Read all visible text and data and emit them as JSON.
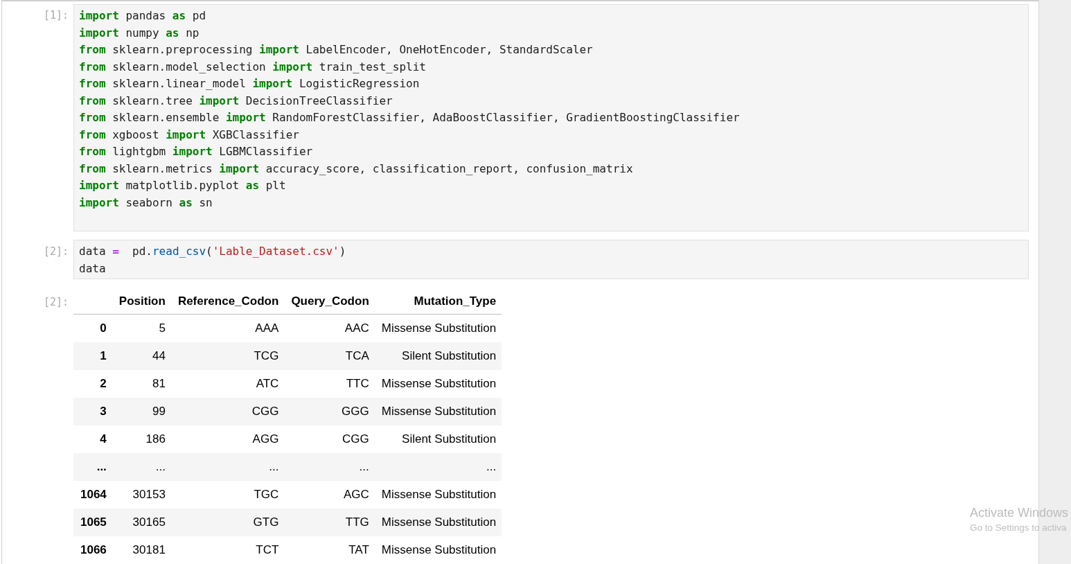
{
  "cells": [
    {
      "prompt": "[1]:",
      "lines": [
        [
          {
            "text": "import",
            "kind": "keyword"
          },
          {
            "text": " pandas ",
            "kind": "plain"
          },
          {
            "text": "as",
            "kind": "keyword"
          },
          {
            "text": " pd",
            "kind": "plain"
          }
        ],
        [
          {
            "text": "import",
            "kind": "keyword"
          },
          {
            "text": " numpy ",
            "kind": "plain"
          },
          {
            "text": "as",
            "kind": "keyword"
          },
          {
            "text": " np",
            "kind": "plain"
          }
        ],
        [
          {
            "text": "from",
            "kind": "keyword"
          },
          {
            "text": " sklearn.preprocessing ",
            "kind": "plain"
          },
          {
            "text": "import",
            "kind": "keyword"
          },
          {
            "text": " LabelEncoder, OneHotEncoder, StandardScaler",
            "kind": "plain"
          }
        ],
        [
          {
            "text": "from",
            "kind": "keyword"
          },
          {
            "text": " sklearn.model_selection ",
            "kind": "plain"
          },
          {
            "text": "import",
            "kind": "keyword"
          },
          {
            "text": " train_test_split",
            "kind": "plain"
          }
        ],
        [
          {
            "text": "from",
            "kind": "keyword"
          },
          {
            "text": " sklearn.linear_model ",
            "kind": "plain"
          },
          {
            "text": "import",
            "kind": "keyword"
          },
          {
            "text": " LogisticRegression",
            "kind": "plain"
          }
        ],
        [
          {
            "text": "from",
            "kind": "keyword"
          },
          {
            "text": " sklearn.tree ",
            "kind": "plain"
          },
          {
            "text": "import",
            "kind": "keyword"
          },
          {
            "text": " DecisionTreeClassifier",
            "kind": "plain"
          }
        ],
        [
          {
            "text": "from",
            "kind": "keyword"
          },
          {
            "text": " sklearn.ensemble ",
            "kind": "plain"
          },
          {
            "text": "import",
            "kind": "keyword"
          },
          {
            "text": " RandomForestClassifier, AdaBoostClassifier, GradientBoostingClassifier",
            "kind": "plain"
          }
        ],
        [
          {
            "text": "from",
            "kind": "keyword"
          },
          {
            "text": " xgboost ",
            "kind": "plain"
          },
          {
            "text": "import",
            "kind": "keyword"
          },
          {
            "text": " XGBClassifier",
            "kind": "plain"
          }
        ],
        [
          {
            "text": "from",
            "kind": "keyword"
          },
          {
            "text": " lightgbm ",
            "kind": "plain"
          },
          {
            "text": "import",
            "kind": "keyword"
          },
          {
            "text": " LGBMClassifier",
            "kind": "plain"
          }
        ],
        [
          {
            "text": "from",
            "kind": "keyword"
          },
          {
            "text": " sklearn.metrics ",
            "kind": "plain"
          },
          {
            "text": "import",
            "kind": "keyword"
          },
          {
            "text": " accuracy_score, classification_report, confusion_matrix",
            "kind": "plain"
          }
        ],
        [
          {
            "text": "import",
            "kind": "keyword"
          },
          {
            "text": " matplotlib.pyplot ",
            "kind": "plain"
          },
          {
            "text": "as",
            "kind": "keyword"
          },
          {
            "text": " plt",
            "kind": "plain"
          }
        ],
        [
          {
            "text": "import",
            "kind": "keyword"
          },
          {
            "text": " seaborn ",
            "kind": "plain"
          },
          {
            "text": "as",
            "kind": "keyword"
          },
          {
            "text": " sn",
            "kind": "plain"
          }
        ]
      ]
    },
    {
      "prompt": "[2]:",
      "lines": [
        [
          {
            "text": "data ",
            "kind": "plain"
          },
          {
            "text": "=",
            "kind": "operator"
          },
          {
            "text": "  pd.",
            "kind": "plain"
          },
          {
            "text": "read_csv",
            "kind": "function"
          },
          {
            "text": "(",
            "kind": "plain"
          },
          {
            "text": "'Lable_Dataset.csv'",
            "kind": "string"
          },
          {
            "text": ")",
            "kind": "plain"
          }
        ],
        [
          {
            "text": "data",
            "kind": "plain"
          }
        ]
      ]
    }
  ],
  "output": {
    "prompt": "[2]:",
    "columns": [
      "Position",
      "Reference_Codon",
      "Query_Codon",
      "Mutation_Type"
    ],
    "rows": [
      {
        "index": "0",
        "cells": [
          "5",
          "AAA",
          "AAC",
          "Missense Substitution"
        ]
      },
      {
        "index": "1",
        "cells": [
          "44",
          "TCG",
          "TCA",
          "Silent Substitution"
        ]
      },
      {
        "index": "2",
        "cells": [
          "81",
          "ATC",
          "TTC",
          "Missense Substitution"
        ]
      },
      {
        "index": "3",
        "cells": [
          "99",
          "CGG",
          "GGG",
          "Missense Substitution"
        ]
      },
      {
        "index": "4",
        "cells": [
          "186",
          "AGG",
          "CGG",
          "Silent Substitution"
        ]
      },
      {
        "index": "...",
        "cells": [
          "...",
          "...",
          "...",
          "..."
        ]
      },
      {
        "index": "1064",
        "cells": [
          "30153",
          "TGC",
          "AGC",
          "Missense Substitution"
        ]
      },
      {
        "index": "1065",
        "cells": [
          "30165",
          "GTG",
          "TTG",
          "Missense Substitution"
        ]
      },
      {
        "index": "1066",
        "cells": [
          "30181",
          "TCT",
          "TAT",
          "Missense Substitution"
        ]
      }
    ]
  },
  "os_notice": {
    "title": "Activate Windows",
    "subtitle": "Go to Settings to activa"
  }
}
